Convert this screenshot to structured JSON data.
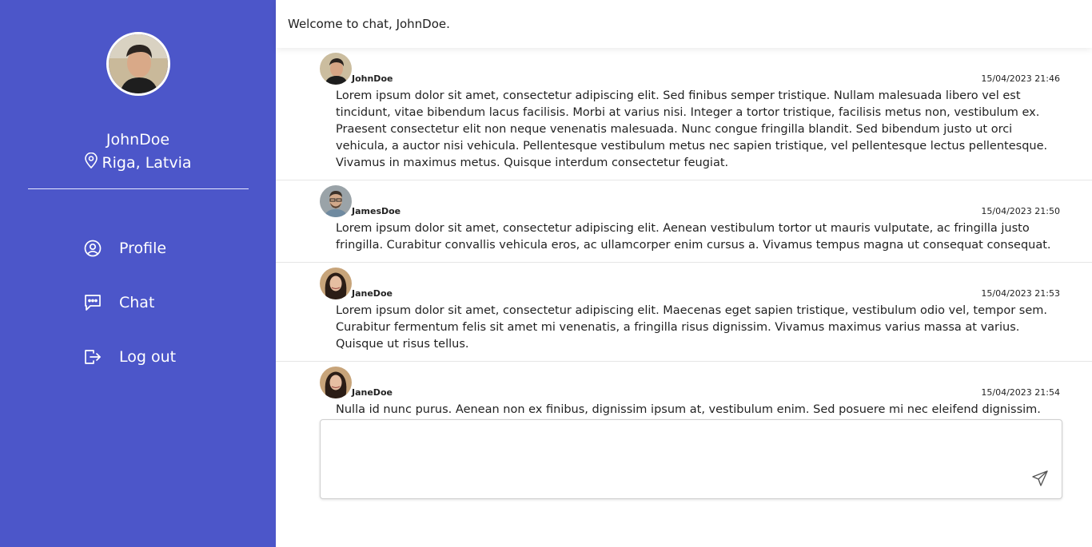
{
  "sidebar": {
    "username": "JohnDoe",
    "location": "Riga, Latvia",
    "nav": [
      {
        "label": "Profile",
        "icon": "user-circle-icon"
      },
      {
        "label": "Chat",
        "icon": "chat-bubble-icon"
      },
      {
        "label": "Log out",
        "icon": "logout-icon"
      }
    ]
  },
  "header": {
    "welcome": "Welcome to chat, JohnDoe."
  },
  "messages": [
    {
      "author": "JohnDoe",
      "timestamp": "15/04/2023 21:46",
      "text": "Lorem ipsum dolor sit amet, consectetur adipiscing elit. Sed finibus semper tristique. Nullam malesuada libero vel est tincidunt, vitae bibendum lacus facilisis. Morbi at varius nisi. Integer a tortor tristique, facilisis metus non, vestibulum ex. Praesent consectetur elit non neque venenatis malesuada. Nunc congue fringilla blandit. Sed bibendum justo ut orci vehicula, a auctor nisi vehicula. Pellentesque vestibulum metus nec sapien tristique, vel pellentesque lectus pellentesque. Vivamus in maximus metus. Quisque interdum consectetur feugiat."
    },
    {
      "author": "JamesDoe",
      "timestamp": "15/04/2023 21:50",
      "text": "Lorem ipsum dolor sit amet, consectetur adipiscing elit. Aenean vestibulum tortor ut mauris vulputate, ac fringilla justo fringilla. Curabitur convallis vehicula eros, ac ullamcorper enim cursus a. Vivamus tempus magna ut consequat consequat."
    },
    {
      "author": "JaneDoe",
      "timestamp": "15/04/2023 21:53",
      "text": "Lorem ipsum dolor sit amet, consectetur adipiscing elit. Maecenas eget sapien tristique, vestibulum odio vel, tempor sem. Curabitur fermentum felis sit amet mi venenatis, a fringilla risus dignissim. Vivamus maximus varius massa at varius. Quisque ut risus tellus."
    },
    {
      "author": "JaneDoe",
      "timestamp": "15/04/2023 21:54",
      "text": "Nulla id nunc purus. Aenean non ex finibus, dignissim ipsum at, vestibulum enim. Sed posuere mi nec eleifend dignissim."
    }
  ],
  "composer": {
    "send_icon": "send-icon"
  },
  "colors": {
    "sidebar": "#4c56c9",
    "text": "#212121"
  }
}
